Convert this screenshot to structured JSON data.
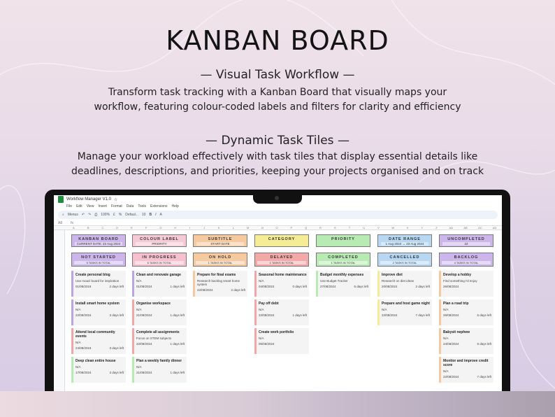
{
  "headline": "KANBAN BOARD",
  "section1": {
    "title": "— Visual Task Workflow —",
    "line1": "Transform task tracking with a Kanban Board that visually maps your",
    "line2": "workflow, featuring colour-coded labels and filters for clarity and efficiency"
  },
  "section2": {
    "title": "— Dynamic Task Tiles —",
    "line1": "Manage your workload effectively with task tiles that display essential details like",
    "line2": "deadlines, descriptions, and priorities, keeping your projects organised and on track"
  },
  "sheet": {
    "doc_title": "Workflow Manager V1.0",
    "menu": [
      "File",
      "Edit",
      "View",
      "Insert",
      "Format",
      "Data",
      "Tools",
      "Extensions",
      "Help"
    ],
    "toolbar": {
      "search": "Menus",
      "zoom": "100%",
      "font": "Defaul...",
      "size": "10"
    },
    "cell_ref": "A8",
    "columns": [
      "A",
      "B",
      "C",
      "D",
      "E",
      "F",
      "G",
      "H",
      "I",
      "J",
      "K",
      "L",
      "M",
      "N",
      "O",
      "P",
      "Q",
      "R",
      "S",
      "T",
      "U",
      "V",
      "W",
      "X",
      "Y",
      "Z",
      "AA",
      "AB",
      "AC",
      "AD"
    ],
    "headers": [
      {
        "title": "KANBAN BOARD",
        "sub": "CURRENT DATE: 22 Aug 2024",
        "color": "#cdb6ec"
      },
      {
        "title": "COLOUR LABEL",
        "sub": "PRIORITY",
        "color": "#f6c9d6"
      },
      {
        "title": "SUBTITLE",
        "sub": "START DATE",
        "color": "#f7c99f"
      },
      {
        "title": "CATEGORY",
        "sub": "",
        "color": "#f5ec95"
      },
      {
        "title": "PRIORITY",
        "sub": "",
        "color": "#b8eab4"
      },
      {
        "title": "DATE RANGE",
        "sub": "1 Aug 2024 → 23 Aug 2024",
        "color": "#b7d7f3"
      },
      {
        "title": "UNCOMPLETED",
        "sub": "22",
        "color": "#cdb6ec"
      }
    ],
    "columns_board": [
      {
        "title": "NOT STARTED",
        "count": "5 TASKS IN TOTAL",
        "color": "#cdb6ec"
      },
      {
        "title": "IN PROGRESS",
        "count": "6 TASKS IN TOTAL",
        "color": "#f6c0cf"
      },
      {
        "title": "ON HOLD",
        "count": "1 TASKS IN TOTAL",
        "color": "#f7c99f"
      },
      {
        "title": "DELAYED",
        "count": "1 TASKS IN TOTAL",
        "color": "#f4a9a9"
      },
      {
        "title": "COMPLETED",
        "count": "1 TASKS IN TOTAL",
        "color": "#b8eab4"
      },
      {
        "title": "CANCELLED",
        "count": "2 TASKS IN TOTAL",
        "color": "#b7d7f3"
      },
      {
        "title": "BACKLOG",
        "count": "4 TASKS IN TOTAL",
        "color": "#cdb6ec"
      }
    ],
    "cards": [
      [
        {
          "name": "Create personal blog",
          "desc": "Use moazi board for inspiration",
          "date": "01/08/2024",
          "left": "2 days left",
          "color": "#b9a6e0"
        },
        {
          "name": "Install smart home system",
          "desc": "N/A",
          "date": "22/08/2024",
          "left": "3 days left",
          "color": "#b9a6e0"
        },
        {
          "name": "Attend local community events",
          "desc": "N/A",
          "date": "24/08/2024",
          "left": "3 days left",
          "color": "#f2a7a7"
        },
        {
          "name": "Deep clean entire house",
          "desc": "N/A",
          "date": "17/08/2024",
          "left": "3 days left",
          "color": "#b8eab4"
        }
      ],
      [
        {
          "name": "Clean and renovate garage",
          "desc": "N/A",
          "date": "01/08/2024",
          "left": "1 days left",
          "color": "#b9a6e0"
        },
        {
          "name": "Organise workspace",
          "desc": "N/A",
          "date": "21/08/2024",
          "left": "1 days left",
          "color": "#f2a7a7"
        },
        {
          "name": "Complete all assignments",
          "desc": "Focus on STEM subjects",
          "date": "22/08/2024",
          "left": "1 days left",
          "color": "#f2a7a7"
        },
        {
          "name": "Plan a weekly family dinner",
          "desc": "N/A",
          "date": "21/08/2024",
          "left": "1 days left",
          "color": "#b8eab4"
        }
      ],
      [
        {
          "name": "Prepare for final exams",
          "desc": "Research backlog smart home system",
          "date": "22/08/2024",
          "left": "2 days left",
          "color": "#f7c99f"
        }
      ],
      [
        {
          "name": "Seasonal home maintenance",
          "desc": "N/A",
          "date": "04/08/2024",
          "left": "0 days left",
          "color": "#f2a7a7"
        },
        {
          "name": "Pay off debt",
          "desc": "N/A",
          "date": "22/08/2024",
          "left": "1 days left",
          "color": "#f2a7a7"
        },
        {
          "name": "Create work portfolio",
          "desc": "N/A",
          "date": "05/08/2024",
          "left": "",
          "color": "#f2a7a7"
        }
      ],
      [
        {
          "name": "Budget monthly expenses",
          "desc": "Use Budget Tracker",
          "date": "27/08/2024",
          "left": "5 days left",
          "color": "#b8eab4"
        }
      ],
      [
        {
          "name": "Improve diet",
          "desc": "Research on diet ideas",
          "date": "20/08/2024",
          "left": "2 days left",
          "color": "#f5ec95"
        },
        {
          "name": "Prepare and host game night",
          "desc": "N/A",
          "date": "22/08/2024",
          "left": "7 days left",
          "color": "#f5ec95"
        }
      ],
      [
        {
          "name": "Develop a hobby",
          "desc": "Find something I'd enjoy",
          "date": "26/08/2024",
          "left": "",
          "color": "#f7c99f"
        },
        {
          "name": "Plan a road trip",
          "desc": "N/A",
          "date": "26/08/2024",
          "left": "6 days left",
          "color": "#f7c99f"
        },
        {
          "name": "Babysit nephew",
          "desc": "N/A",
          "date": "24/08/2024",
          "left": "6 days left",
          "color": "#f7c99f"
        },
        {
          "name": "Monitor and improve credit score",
          "desc": "N/A",
          "date": "22/08/2024",
          "left": "7 days left",
          "color": "#f7c99f"
        }
      ]
    ]
  }
}
